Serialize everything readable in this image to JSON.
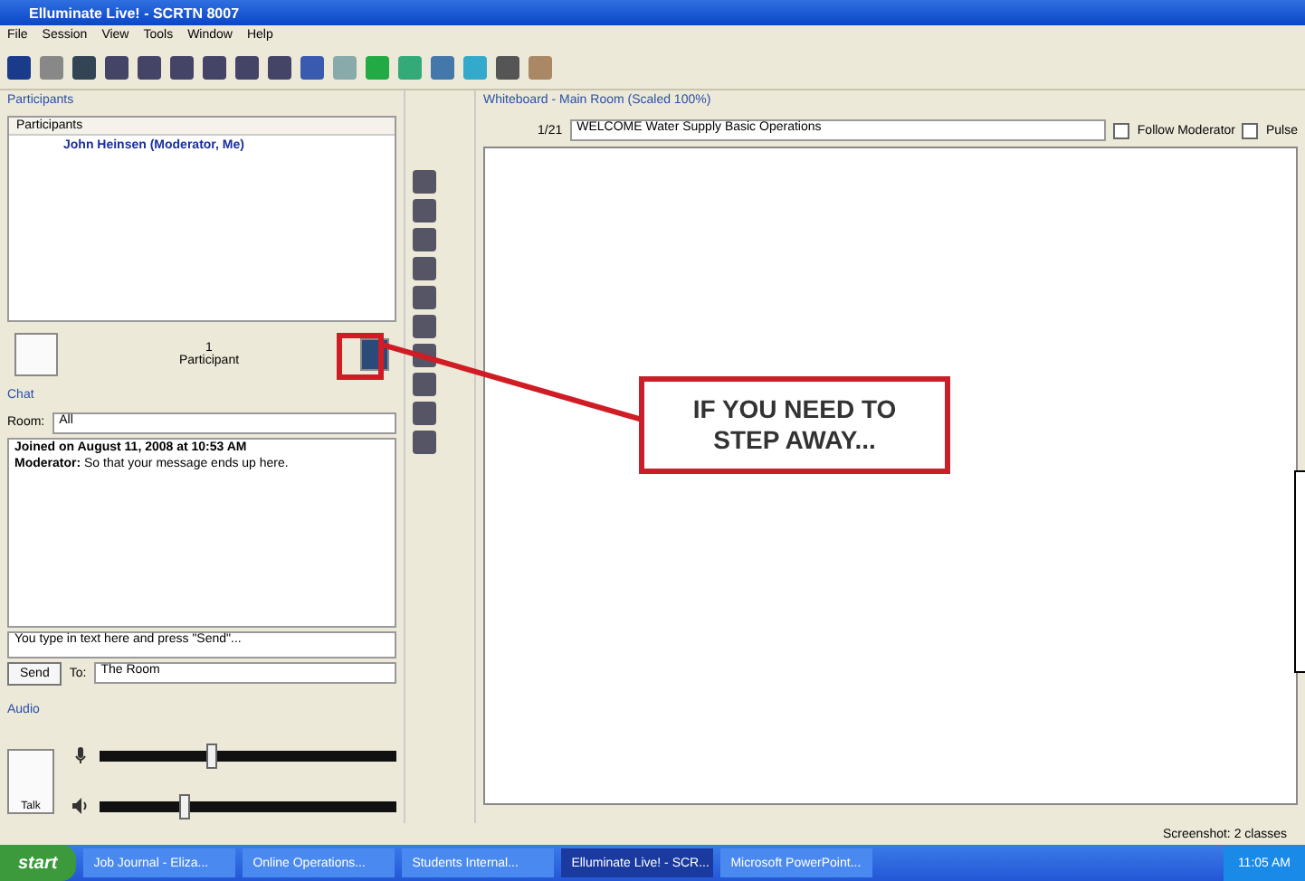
{
  "window": {
    "title": "Elluminate Live! - SCRTN 8007"
  },
  "menu": [
    "File",
    "Session",
    "View",
    "Tools",
    "Window",
    "Help"
  ],
  "participants": {
    "title": "Participants",
    "column": "Participants",
    "rows": [
      {
        "name": "John Heinsen (Moderator, Me)"
      }
    ],
    "count": "1",
    "count_label": "Participant"
  },
  "chat": {
    "title": "Chat",
    "room_label": "Room:",
    "room": "All",
    "messages": [
      {
        "text": "Joined on August 11, 2008 at 10:53 AM",
        "kind": "system"
      },
      {
        "text": "**Moderator:** So that your message ends up here.",
        "kind": "message"
      }
    ],
    "input": "You type in text here and press \"Send\"...",
    "send": "Send",
    "to_label": "To:",
    "to": "The Room"
  },
  "audio": {
    "title": "Audio",
    "talk": "Talk",
    "sliders": [
      {
        "kind": "mic",
        "level": 0.36
      },
      {
        "kind": "speaker",
        "level": 0.27
      }
    ]
  },
  "whiteboard": {
    "title": "Whiteboard - Main Room (Scaled 100%)",
    "page": "1/21",
    "screen": "WELCOME Water Supply Basic Operations",
    "follow": {
      "label": "Follow Moderator",
      "checked": false
    },
    "pulse": {
      "label": "Pulse",
      "checked": false
    }
  },
  "status": "Screenshot: 2 classes",
  "callout": "IF YOU NEED TO STEP AWAY...",
  "taskbar": {
    "start": "start",
    "items": [
      {
        "label": "Job Journal - Eliza...",
        "selected": false
      },
      {
        "label": "Online Operations...",
        "selected": false
      },
      {
        "label": "Students Internal...",
        "selected": false
      },
      {
        "label": "Elluminate Live! - SCR...",
        "selected": true
      },
      {
        "label": "Microsoft PowerPoint...",
        "selected": false
      }
    ],
    "clock": "11:05 AM"
  }
}
